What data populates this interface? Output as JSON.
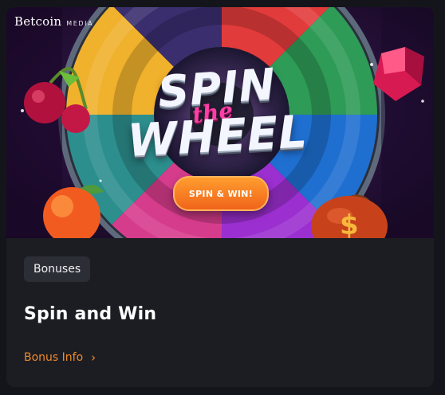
{
  "brand": {
    "name": "Betcoin",
    "sub": "MEDIA"
  },
  "banner": {
    "title_line1": "SPIN",
    "title_middle": "the",
    "title_line2": "WHEEL",
    "cta_label": "SPIN & WIN!",
    "accent_color": "#f0641a"
  },
  "card": {
    "tag": "Bonuses",
    "title": "Spin and Win",
    "link_label": "Bonus Info",
    "link_icon": "chevron-right-icon",
    "link_color": "#f08a2a"
  }
}
